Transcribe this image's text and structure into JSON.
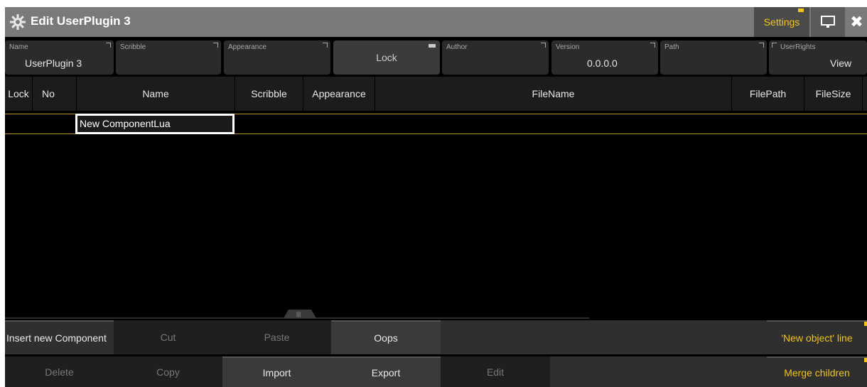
{
  "window": {
    "title": "Edit UserPlugin 3",
    "settings_label": "Settings",
    "accent_color": "#f0c41c"
  },
  "props": {
    "name_label": "Name",
    "name_value": "UserPlugin 3",
    "scribble_label": "Scribble",
    "appearance_label": "Appearance",
    "lock_value": "Lock",
    "author_label": "Author",
    "version_label": "Version",
    "version_value": "0.0.0.0",
    "path_label": "Path",
    "userrights_label": "UserRights",
    "userrights_value": "View"
  },
  "table": {
    "columns": [
      "Lock",
      "No",
      "Name",
      "Scribble",
      "Appearance",
      "FileName",
      "FilePath",
      "FileSize"
    ],
    "new_row_name": "New ComponentLua"
  },
  "buttons": {
    "insert": "Insert new Component",
    "cut": "Cut",
    "paste": "Paste",
    "oops": "Oops",
    "new_object_line": "'New object' line",
    "delete": "Delete",
    "copy": "Copy",
    "import": "Import",
    "export": "Export",
    "edit": "Edit",
    "merge_children": "Merge children"
  }
}
